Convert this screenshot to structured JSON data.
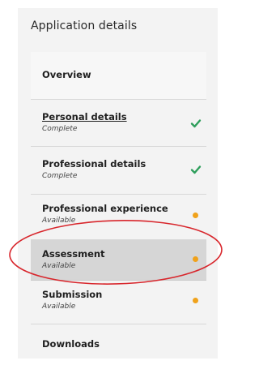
{
  "panel": {
    "title": "Application details"
  },
  "nav": {
    "items": [
      {
        "label": "Overview",
        "status": ""
      },
      {
        "label": "Personal details",
        "status": "Complete",
        "indicator": "check"
      },
      {
        "label": "Professional details",
        "status": "Complete",
        "indicator": "check"
      },
      {
        "label": "Professional experience",
        "status": "Available",
        "indicator": "dot"
      },
      {
        "label": "Assessment",
        "status": "Available",
        "indicator": "dot",
        "selected": true
      },
      {
        "label": "Submission",
        "status": "Available",
        "indicator": "dot"
      },
      {
        "label": "Downloads",
        "status": ""
      }
    ]
  },
  "colors": {
    "panel_bg": "#f3f3f3",
    "selected_bg": "#d6d6d6",
    "check_green": "#2e9e5b",
    "dot_orange": "#f0a21b",
    "annotation_red": "#d8262c"
  }
}
